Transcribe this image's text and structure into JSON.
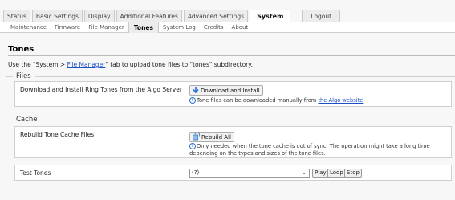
{
  "main_tabs": [
    "Status",
    "Basic Settings",
    "Display",
    "Additional Features",
    "Advanced Settings",
    "System",
    "Logout"
  ],
  "sub_tabs": [
    "Maintenance",
    "Firmware",
    "File Manager",
    "Tones",
    "System Log",
    "Credits",
    "About"
  ],
  "page": {
    "title": "Tones",
    "intro_prefix": "Use the \"System > ",
    "intro_link": "File Manager",
    "intro_suffix": "\" tab to upload tone files to \"tones\" subdirectory."
  },
  "files": {
    "legend": "Files",
    "row_label": "Download and Install Ring Tones from the Algo Server",
    "button_label": "Download and Install",
    "hint_prefix": "Tone files can be downloaded manually from ",
    "hint_link": "the Algo website",
    "hint_suffix": "."
  },
  "cache": {
    "legend": "Cache",
    "row_label": "Rebuild Tone Cache Files",
    "button_label": "Rebuild All",
    "hint": "Only needed when the tone cache is out of sync. The operation might take a long time depending on the types and sizes of the tone files."
  },
  "test_tones": {
    "label": "Test Tones",
    "selected": "(?)",
    "play": "Play",
    "loop": "Loop",
    "stop": "Stop"
  }
}
